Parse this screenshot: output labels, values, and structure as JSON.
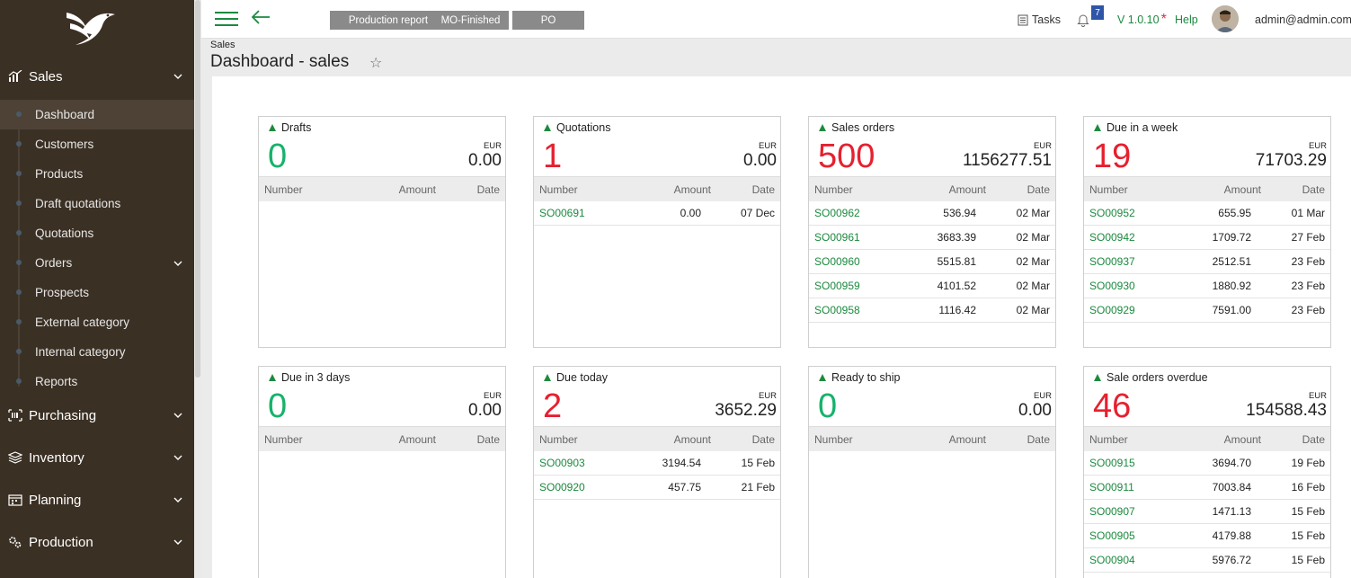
{
  "sidebar": {
    "sections": [
      {
        "label": "Sales",
        "icon": "bar-chart-icon"
      },
      {
        "label": "Purchasing",
        "icon": "barcode-icon"
      },
      {
        "label": "Inventory",
        "icon": "layers-icon"
      },
      {
        "label": "Planning",
        "icon": "calendar-icon"
      },
      {
        "label": "Production",
        "icon": "gears-icon"
      }
    ],
    "sales_items": [
      {
        "label": "Dashboard"
      },
      {
        "label": "Customers"
      },
      {
        "label": "Products"
      },
      {
        "label": "Draft quotations"
      },
      {
        "label": "Quotations"
      },
      {
        "label": "Orders"
      },
      {
        "label": "Prospects"
      },
      {
        "label": "External category"
      },
      {
        "label": "Internal category"
      },
      {
        "label": "Reports"
      }
    ]
  },
  "topbar": {
    "quick": [
      "Production report",
      "MO-Finished",
      "PO"
    ],
    "tasks": "Tasks",
    "notifications": "7",
    "version": "V 1.0.10",
    "version_mark": "*",
    "help": "Help",
    "user": "admin@admin.com"
  },
  "page": {
    "breadcrumb": "Sales",
    "title": "Dashboard - sales",
    "fav_icon": "☆"
  },
  "columns": {
    "number": "Number",
    "amount": "Amount",
    "date": "Date"
  },
  "cards": [
    {
      "title": "Drafts",
      "count": "0",
      "currency": "EUR",
      "total": "0.00",
      "rows": []
    },
    {
      "title": "Quotations",
      "count": "1",
      "currency": "EUR",
      "total": "0.00",
      "rows": [
        {
          "number": "SO00691",
          "amount": "0.00",
          "date": "07 Dec"
        }
      ]
    },
    {
      "title": "Sales orders",
      "count": "500",
      "currency": "EUR",
      "total": "1156277.51",
      "rows": [
        {
          "number": "SO00962",
          "amount": "536.94",
          "date": "02 Mar"
        },
        {
          "number": "SO00961",
          "amount": "3683.39",
          "date": "02 Mar"
        },
        {
          "number": "SO00960",
          "amount": "5515.81",
          "date": "02 Mar"
        },
        {
          "number": "SO00959",
          "amount": "4101.52",
          "date": "02 Mar"
        },
        {
          "number": "SO00958",
          "amount": "1116.42",
          "date": "02 Mar"
        }
      ]
    },
    {
      "title": "Due in a week",
      "count": "19",
      "currency": "EUR",
      "total": "71703.29",
      "rows": [
        {
          "number": "SO00952",
          "amount": "655.95",
          "date": "01 Mar"
        },
        {
          "number": "SO00942",
          "amount": "1709.72",
          "date": "27 Feb"
        },
        {
          "number": "SO00937",
          "amount": "2512.51",
          "date": "23 Feb"
        },
        {
          "number": "SO00930",
          "amount": "1880.92",
          "date": "23 Feb"
        },
        {
          "number": "SO00929",
          "amount": "7591.00",
          "date": "23 Feb"
        }
      ]
    },
    {
      "title": "Due in 3 days",
      "count": "0",
      "currency": "EUR",
      "total": "0.00",
      "rows": []
    },
    {
      "title": "Due today",
      "count": "2",
      "currency": "EUR",
      "total": "3652.29",
      "rows": [
        {
          "number": "SO00903",
          "amount": "3194.54",
          "date": "15 Feb"
        },
        {
          "number": "SO00920",
          "amount": "457.75",
          "date": "21 Feb"
        }
      ]
    },
    {
      "title": "Ready to ship",
      "count": "0",
      "currency": "EUR",
      "total": "0.00",
      "rows": []
    },
    {
      "title": "Sale orders overdue",
      "count": "46",
      "currency": "EUR",
      "total": "154588.43",
      "rows": [
        {
          "number": "SO00915",
          "amount": "3694.70",
          "date": "19 Feb"
        },
        {
          "number": "SO00911",
          "amount": "7003.84",
          "date": "16 Feb"
        },
        {
          "number": "SO00907",
          "amount": "1471.13",
          "date": "15 Feb"
        },
        {
          "number": "SO00905",
          "amount": "4179.88",
          "date": "15 Feb"
        },
        {
          "number": "SO00904",
          "amount": "5976.72",
          "date": "15 Feb"
        }
      ]
    }
  ],
  "colors": {
    "accent": "#1b8a3e",
    "zero": "#17b26b",
    "nonzero": "#e6202f",
    "sidebar": "#3b3024"
  }
}
